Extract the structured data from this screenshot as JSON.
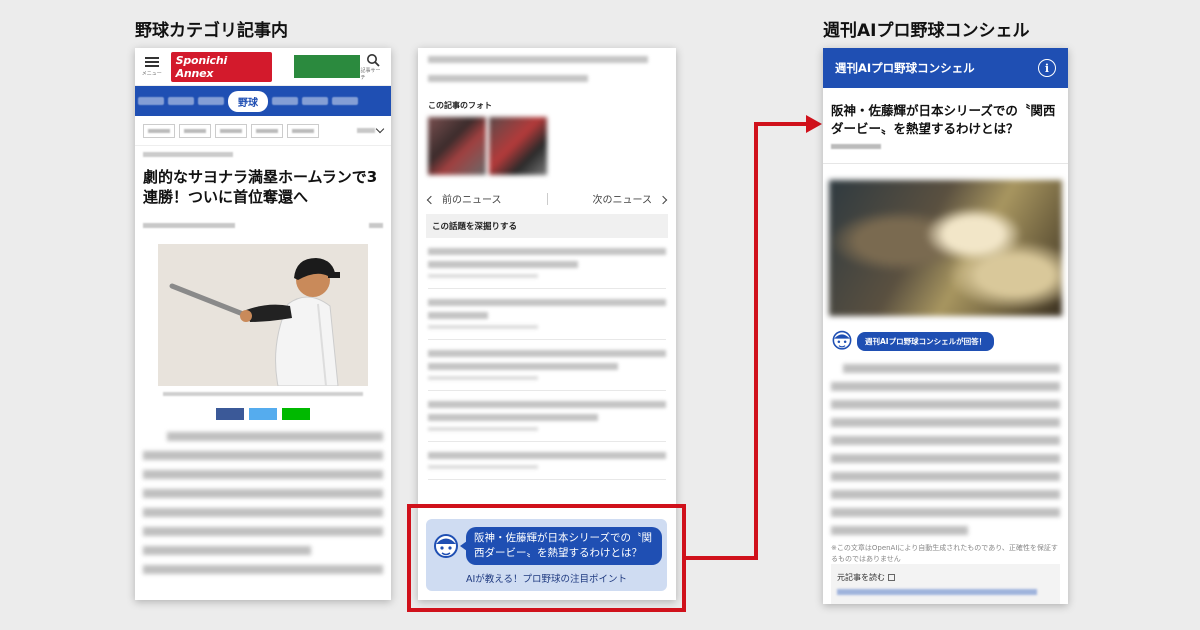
{
  "headings": {
    "left": "野球カテゴリ記事内",
    "right": "週刊AIプロ野球コンシェル"
  },
  "phone1": {
    "menu_label": "メニュー",
    "logo_text": "Sponichi Annex",
    "search_label": "記事サーチ",
    "nav_active": "野球",
    "article_title": "劇的なサヨナラ満塁ホームランで3連勝！ついに首位奪還へ"
  },
  "phone2": {
    "photo_label": "この記事のフォト",
    "prev_news": "前のニュース",
    "next_news": "次のニュース",
    "deep_dive": "この話題を深掘りする",
    "promo_title": "阪神・佐藤輝が日本シリーズでの〝関西ダービー〟を熱望するわけとは？",
    "promo_sub": "AIが教える！プロ野球の注目ポイント"
  },
  "phone3": {
    "header_title": "週刊AIプロ野球コンシェル",
    "article_title": "阪神・佐藤輝が日本シリーズでの〝関西ダービー〟を熱望するわけとは？",
    "ai_badge": "週刊AIプロ野球コンシェルが回答！",
    "note": "※この文章はOpenAIにより自動生成されたものであり、正確性を保証するものではありません",
    "source_link": "元記事を読む"
  },
  "colors": {
    "brand_blue": "#1f4fb3",
    "highlight_red": "#d0111b",
    "promo_bg": "#cfdcf2"
  }
}
